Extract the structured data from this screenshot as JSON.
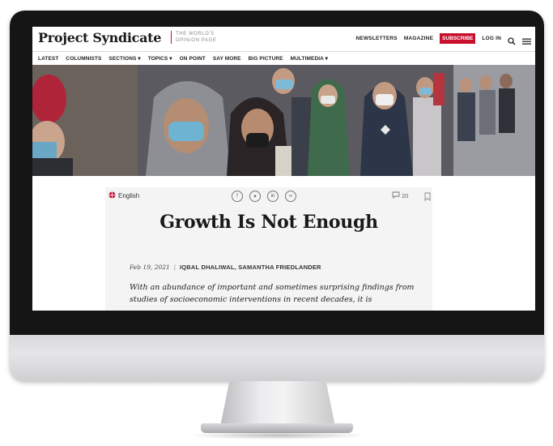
{
  "site": {
    "logo": "Project Syndicate",
    "tagline": "THE WORLD'S OPINION PAGE"
  },
  "header": {
    "links": [
      "NEWSLETTERS",
      "MAGAZINE"
    ],
    "subscribe": "SUBSCRIBE",
    "login": "LOG IN"
  },
  "nav": {
    "items": [
      "LATEST",
      "COLUMNISTS",
      "SECTIONS ▾",
      "TOPICS ▾",
      "ON POINT",
      "SAY MORE",
      "BIG PICTURE",
      "MULTIMEDIA ▾"
    ]
  },
  "article": {
    "language": "English",
    "comment_count": "20",
    "title": "Growth Is Not Enough",
    "date": "Feb 19, 2021",
    "authors": "IQBAL DHALIWAL, SAMANTHA FRIEDLANDER",
    "lede": "With an abundance of important and sometimes surprising findings from studies of socioeconomic interventions in recent decades, it is"
  },
  "colors": {
    "accent": "#c8102e",
    "bezel": "#151515"
  }
}
